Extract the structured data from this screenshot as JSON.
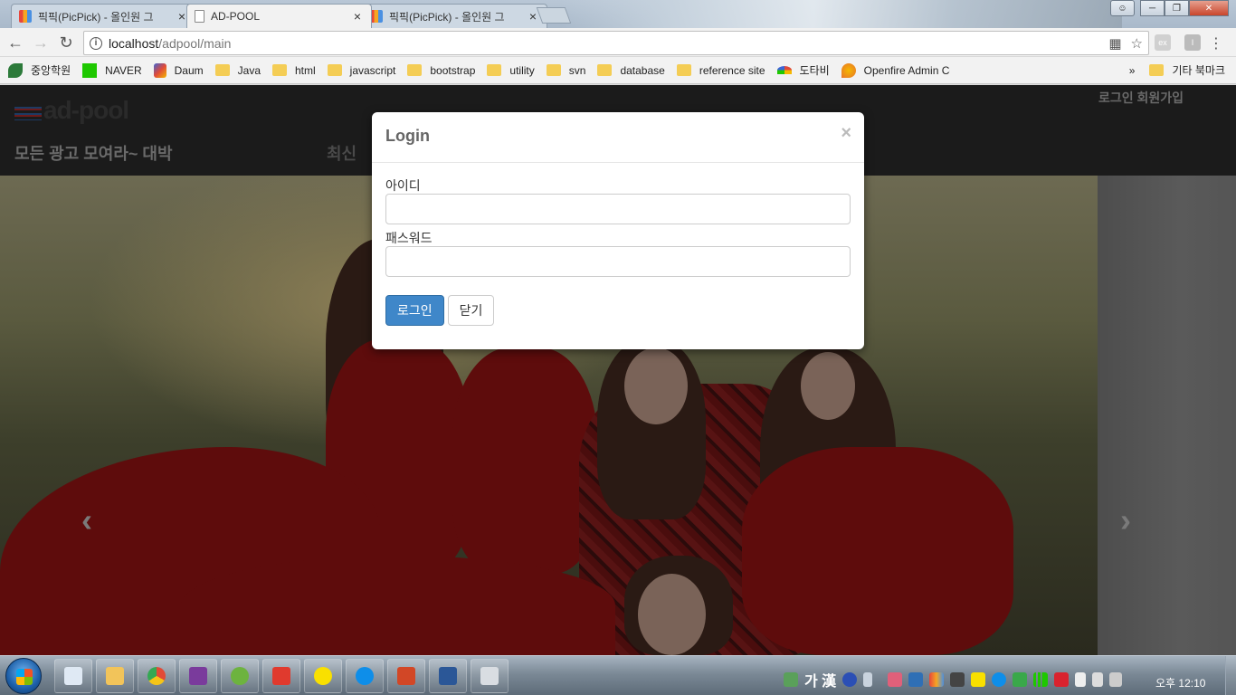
{
  "browser": {
    "tabs": [
      {
        "title": "픽픽(PicPick) - 올인원 그",
        "active": false
      },
      {
        "title": "AD-POOL",
        "active": true
      },
      {
        "title": "픽픽(PicPick) - 올인원 그",
        "active": false
      }
    ],
    "close_glyph": "×",
    "url_host": "localhost",
    "url_path": "/adpool/main",
    "translate_icon": "translate-icon",
    "ext_label_1": "ex",
    "ext_label_2": "I"
  },
  "bookmarks": {
    "items": [
      {
        "label": "중앙학원",
        "icon": "site-icon",
        "color": "#2c7a3a"
      },
      {
        "label": "NAVER",
        "icon": "naver-icon",
        "color": "#1ec800"
      },
      {
        "label": "Daum",
        "icon": "daum-icon",
        "color": "#3c64d6"
      },
      {
        "label": "Java",
        "icon": "folder-icon",
        "color": "#f4cd55"
      },
      {
        "label": "html",
        "icon": "folder-icon",
        "color": "#f4cd55"
      },
      {
        "label": "javascript",
        "icon": "folder-icon",
        "color": "#f4cd55"
      },
      {
        "label": "bootstrap",
        "icon": "folder-icon",
        "color": "#f4cd55"
      },
      {
        "label": "utility",
        "icon": "folder-icon",
        "color": "#f4cd55"
      },
      {
        "label": "svn",
        "icon": "folder-icon",
        "color": "#f4cd55"
      },
      {
        "label": "database",
        "icon": "folder-icon",
        "color": "#f4cd55"
      },
      {
        "label": "reference site",
        "icon": "folder-icon",
        "color": "#f4cd55"
      },
      {
        "label": "도타비",
        "icon": "umbrella-icon",
        "color": "#e04a3a"
      },
      {
        "label": "Openfire Admin Co",
        "icon": "openfire-icon",
        "color": "#e8742a"
      }
    ],
    "overflow": "»",
    "other_bookmarks": "기타 북마크"
  },
  "site": {
    "logo_text": "ad-pool",
    "slogan": "모든 광고 모여라~ 대박",
    "nav_latest": "최신",
    "login_link": "로그인",
    "signup_link": "회원가입",
    "carousel_prev": "‹",
    "carousel_next": "›"
  },
  "modal": {
    "title": "Login",
    "close_glyph": "×",
    "id_label": "아이디",
    "id_value": "",
    "password_label": "패스워드",
    "password_value": "",
    "login_button": "로그인",
    "close_button": "닫기"
  },
  "taskbar": {
    "ime_text": "가 漢",
    "clock": "오후 12:10",
    "pinned": [
      {
        "icon": "file-icon",
        "color": "#dfe9f4"
      },
      {
        "icon": "explorer-icon",
        "color": "#f2c45a"
      },
      {
        "icon": "chrome-icon",
        "color": "#e24a36"
      },
      {
        "icon": "onenote-icon",
        "color": "#7a3b9c"
      },
      {
        "icon": "spring-icon",
        "color": "#6db33f"
      },
      {
        "icon": "xmind-icon",
        "color": "#e03a2e"
      },
      {
        "icon": "kakaotalk-icon",
        "color": "#f9e000"
      },
      {
        "icon": "teamviewer-icon",
        "color": "#0e8ee9"
      },
      {
        "icon": "powerpoint-icon",
        "color": "#d24726"
      },
      {
        "icon": "word-icon",
        "color": "#2b5797"
      },
      {
        "icon": "calculator-icon",
        "color": "#d9dde2"
      }
    ]
  }
}
